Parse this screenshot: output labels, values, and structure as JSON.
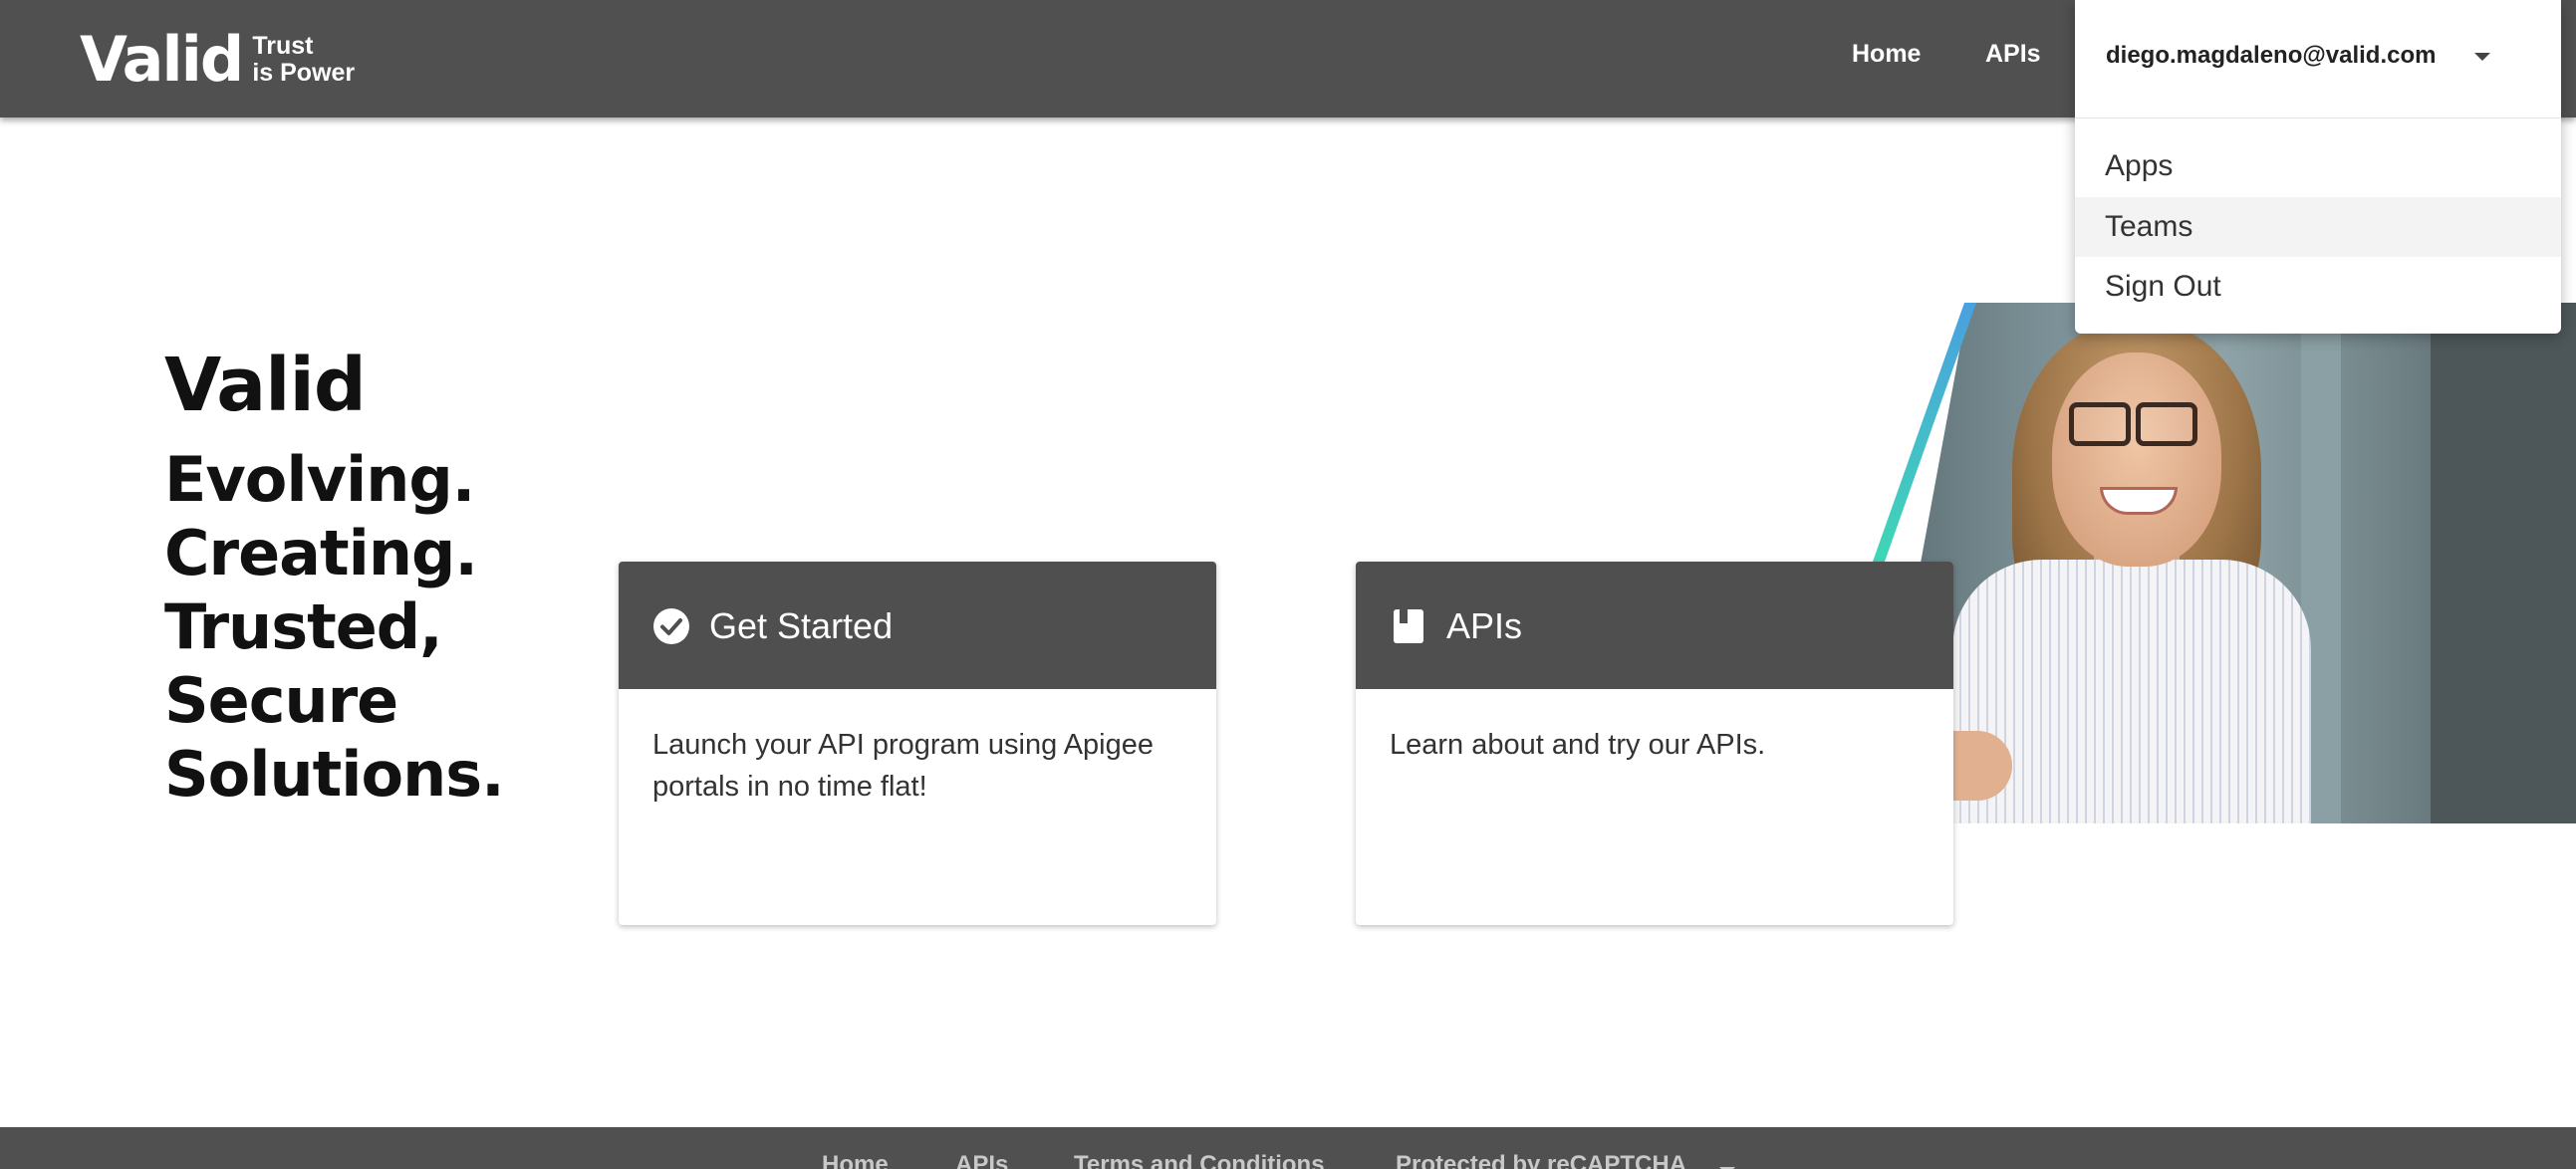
{
  "header": {
    "logo": {
      "word": "Valid",
      "tag_line_1": "Trust",
      "tag_line_2": "is Power"
    },
    "nav": {
      "home": "Home",
      "apis": "APIs"
    },
    "user": {
      "email": "diego.magdaleno@valid.com"
    }
  },
  "user_menu": {
    "items": [
      "Apps",
      "Teams",
      "Sign Out"
    ],
    "highlighted": "Teams"
  },
  "hero": {
    "title": "Valid",
    "tagline": "Evolving.\nCreating.\nTrusted, Secure\nSolutions."
  },
  "cards": [
    {
      "icon": "check-circle-icon",
      "title": "Get Started",
      "description": "Launch your API program using Apigee portals in no time flat!"
    },
    {
      "icon": "book-icon",
      "title": "APIs",
      "description": "Learn about and try our APIs."
    }
  ],
  "footer": {
    "links": [
      "Home",
      "APIs",
      "Terms and Conditions",
      "Protected by reCAPTCHA"
    ]
  },
  "colors": {
    "header_bg": "#505050",
    "card_header_bg": "#4f4f4f",
    "menu_highlight": "#f3f3f3",
    "accent_gradient_start": "#4aa0e0",
    "accent_gradient_end": "#3fd7b5"
  }
}
